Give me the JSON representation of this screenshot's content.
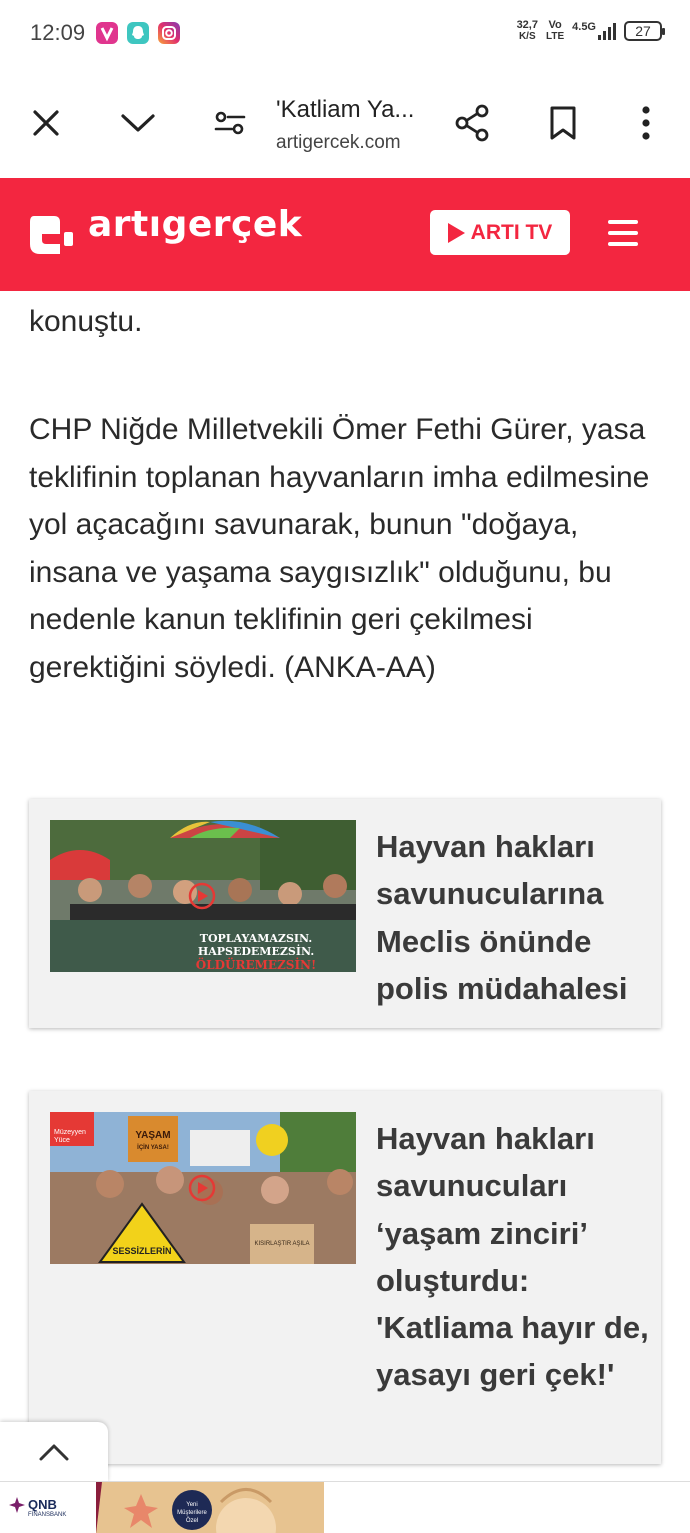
{
  "status_bar": {
    "time": "12:09",
    "net_speed": "32,7",
    "net_speed_unit": "K/S",
    "volte_top": "Vo",
    "volte_bottom": "LTE",
    "network": "4.5G",
    "battery": "27"
  },
  "browser": {
    "tab_title": "'Katliam Ya...",
    "domain": "artigercek.com",
    "icons": [
      "close-icon",
      "chevron-down-icon",
      "tune-icon",
      "share-icon",
      "bookmark-icon",
      "more-vert-icon"
    ]
  },
  "site": {
    "logo_text": "artıgerçek",
    "arti_tv_label": "ARTI TV",
    "brand_color": "#f32640"
  },
  "article": {
    "continuation": "konuştu.",
    "paragraph": "CHP Niğde Milletvekili Ömer Fethi Gürer, yasa teklifinin toplanan hayvanların imha edilmesine yol açacağını savunarak, bunun \"doğaya, insana ve yaşama saygısızlık\" olduğunu, bu nedenle kanun teklifinin geri çekilmesi gerektiğini söyledi. (ANKA-AA)"
  },
  "related": [
    {
      "title": "Hayvan hakları savunucularına Meclis önünde polis müdahalesi",
      "thumb_banner_line1": "TOPLAYAMAZSIN.",
      "thumb_banner_line2": "HAPSEDEMEZSİN.",
      "thumb_banner_line3": "ÖLDÜREMEZSİN!"
    },
    {
      "title": "Hayvan hakları savunucuları ‘yaşam zinciri’ oluşturdu: 'Katliama hayır de, yasayı geri çek!'",
      "thumb_corner_1": "Müzeyyen",
      "thumb_corner_2": "Yüce",
      "thumb_sign1": "YAŞAM",
      "thumb_sign1b": "İÇİN YASA!",
      "thumb_sign2": "SESSİZLERİN",
      "thumb_sign3": "KISIRLAŞTIR AŞILA"
    }
  ],
  "ad": {
    "brand": "QNB",
    "brand_sub": "FİNANSBANK",
    "badge_line1": "Yeni",
    "badge_line2": "Müşterilere",
    "badge_line3": "Özel"
  }
}
